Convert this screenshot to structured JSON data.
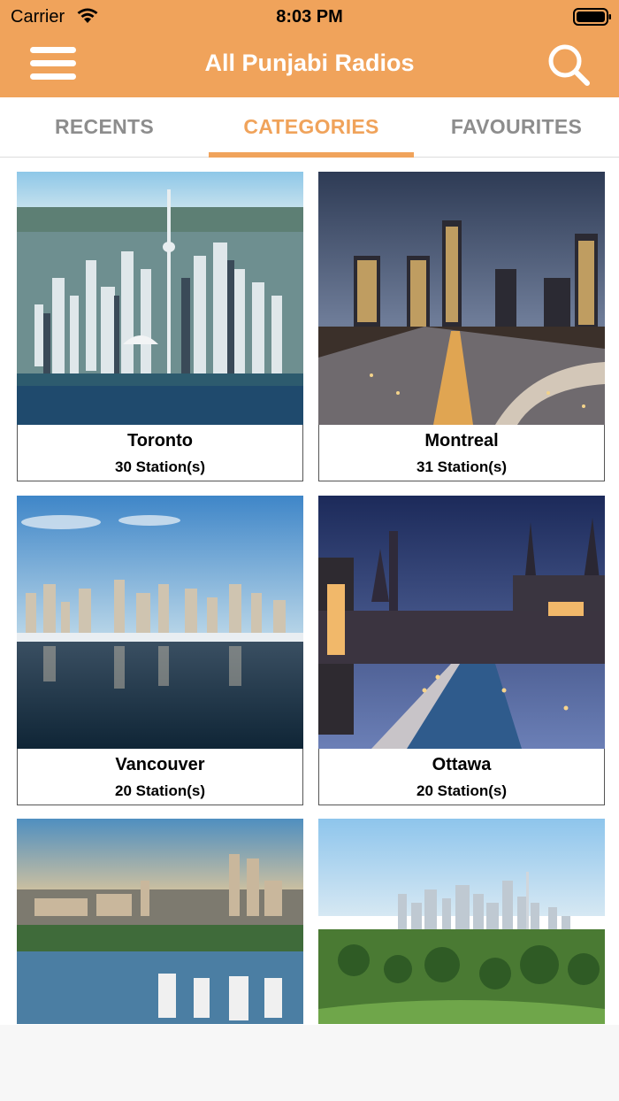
{
  "status_bar": {
    "carrier": "Carrier",
    "time": "8:03 PM",
    "wifi_icon": "wifi-icon",
    "battery_icon": "battery-full-icon"
  },
  "nav": {
    "title": "All Punjabi Radios",
    "menu_icon": "hamburger-menu-icon",
    "search_icon": "search-icon",
    "bar_color": "#F0A35B"
  },
  "tabs": [
    {
      "label": "RECENTS",
      "selected": false
    },
    {
      "label": "CATEGORIES",
      "selected": true
    },
    {
      "label": "FAVOURITES",
      "selected": false
    }
  ],
  "accent_color": "#F0A35B",
  "categories": [
    {
      "name": "Toronto",
      "stations": "30 Station(s)"
    },
    {
      "name": "Montreal",
      "stations": "31 Station(s)"
    },
    {
      "name": "Vancouver",
      "stations": "20 Station(s)"
    },
    {
      "name": "Ottawa",
      "stations": "20 Station(s)"
    },
    {
      "name": "",
      "stations": ""
    },
    {
      "name": "",
      "stations": ""
    }
  ]
}
